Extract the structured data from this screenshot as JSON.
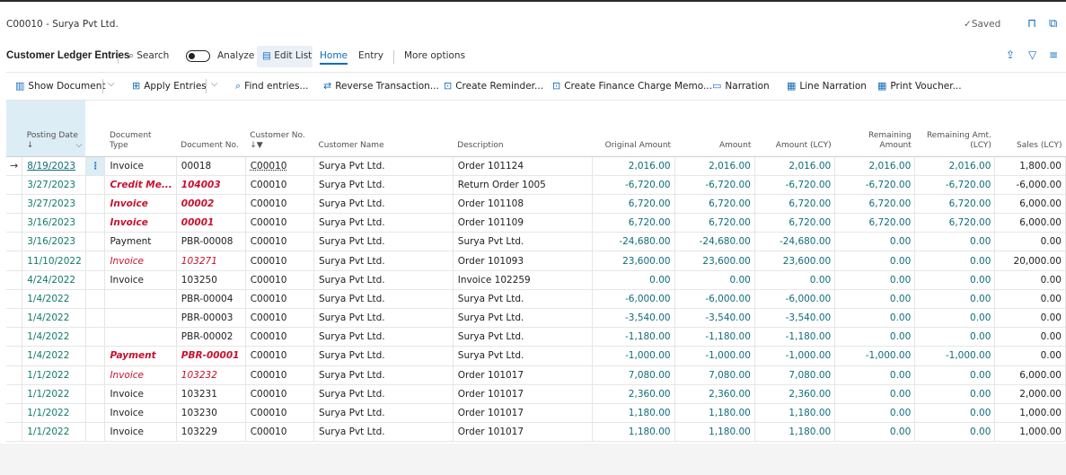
{
  "window": {
    "title": "C00010 - Surya Pvt Ltd.",
    "saved_label": "Saved"
  },
  "actionbar": {
    "page_name": "Customer Ledger Entries",
    "search": "Search",
    "analyze": "Analyze",
    "edit_list": "Edit List",
    "home": "Home",
    "entry": "Entry",
    "more": "More options"
  },
  "commands": {
    "show_document": "Show Document",
    "apply_entries": "Apply Entries",
    "find_entries": "Find entries...",
    "reverse": "Reverse Transaction...",
    "reminder": "Create Reminder...",
    "finance_memo": "Create Finance Charge Memo...",
    "narration": "Narration",
    "line_narration": "Line Narration",
    "print_voucher": "Print Voucher..."
  },
  "columns": {
    "posting_date": "Posting Date",
    "doc_type_1": "Document",
    "doc_type_2": "Type",
    "doc_no": "Document No.",
    "cust_no": "Customer No.",
    "cust_name": "Customer Name",
    "description": "Description",
    "orig_amount": "Original Amount",
    "amount": "Amount",
    "amount_lcy": "Amount (LCY)",
    "remaining_1": "Remaining",
    "remaining_2": "Amount",
    "rem_lcy_1": "Remaining Amt.",
    "rem_lcy_2": "(LCY)",
    "sales_lcy": "Sales (LCY)"
  },
  "rows": [
    {
      "date": "8/19/2023",
      "type": "Invoice",
      "docno": "00018",
      "cust": "C00010",
      "name": "Surya Pvt Ltd.",
      "desc": "Order 101124",
      "orig": "2,016.00",
      "amt": "2,016.00",
      "lcy": "2,016.00",
      "rem": "2,016.00",
      "remlcy": "2,016.00",
      "sales": "1,800.00",
      "style": ""
    },
    {
      "date": "3/27/2023",
      "type": "Credit Me...",
      "docno": "104003",
      "cust": "C00010",
      "name": "Surya Pvt Ltd.",
      "desc": "Return Order 1005",
      "orig": "-6,720.00",
      "amt": "-6,720.00",
      "lcy": "-6,720.00",
      "rem": "-6,720.00",
      "remlcy": "-6,720.00",
      "sales": "-6,000.00",
      "style": "bold"
    },
    {
      "date": "3/27/2023",
      "type": "Invoice",
      "docno": "00002",
      "cust": "C00010",
      "name": "Surya Pvt Ltd.",
      "desc": "Order 101108",
      "orig": "6,720.00",
      "amt": "6,720.00",
      "lcy": "6,720.00",
      "rem": "6,720.00",
      "remlcy": "6,720.00",
      "sales": "6,000.00",
      "style": "bold"
    },
    {
      "date": "3/16/2023",
      "type": "Invoice",
      "docno": "00001",
      "cust": "C00010",
      "name": "Surya Pvt Ltd.",
      "desc": "Order 101109",
      "orig": "6,720.00",
      "amt": "6,720.00",
      "lcy": "6,720.00",
      "rem": "6,720.00",
      "remlcy": "6,720.00",
      "sales": "6,000.00",
      "style": "bold"
    },
    {
      "date": "3/16/2023",
      "type": "Payment",
      "docno": "PBR-00008",
      "cust": "C00010",
      "name": "Surya Pvt Ltd.",
      "desc": "Surya Pvt Ltd.",
      "orig": "-24,680.00",
      "amt": "-24,680.00",
      "lcy": "-24,680.00",
      "rem": "0.00",
      "remlcy": "0.00",
      "sales": "0.00",
      "style": ""
    },
    {
      "date": "11/10/2022",
      "type": "Invoice",
      "docno": "103271",
      "cust": "C00010",
      "name": "Surya Pvt Ltd.",
      "desc": "Order 101093",
      "orig": "23,600.00",
      "amt": "23,600.00",
      "lcy": "23,600.00",
      "rem": "0.00",
      "remlcy": "0.00",
      "sales": "20,000.00",
      "style": "ital"
    },
    {
      "date": "4/24/2022",
      "type": "Invoice",
      "docno": "103250",
      "cust": "C00010",
      "name": "Surya Pvt Ltd.",
      "desc": "Invoice 102259",
      "orig": "0.00",
      "amt": "0.00",
      "lcy": "0.00",
      "rem": "0.00",
      "remlcy": "0.00",
      "sales": "0.00",
      "style": ""
    },
    {
      "date": "1/4/2022",
      "type": "",
      "docno": "PBR-00004",
      "cust": "C00010",
      "name": "Surya Pvt Ltd.",
      "desc": "Surya Pvt Ltd.",
      "orig": "-6,000.00",
      "amt": "-6,000.00",
      "lcy": "-6,000.00",
      "rem": "0.00",
      "remlcy": "0.00",
      "sales": "0.00",
      "style": ""
    },
    {
      "date": "1/4/2022",
      "type": "",
      "docno": "PBR-00003",
      "cust": "C00010",
      "name": "Surya Pvt Ltd.",
      "desc": "Surya Pvt Ltd.",
      "orig": "-3,540.00",
      "amt": "-3,540.00",
      "lcy": "-3,540.00",
      "rem": "0.00",
      "remlcy": "0.00",
      "sales": "0.00",
      "style": ""
    },
    {
      "date": "1/4/2022",
      "type": "",
      "docno": "PBR-00002",
      "cust": "C00010",
      "name": "Surya Pvt Ltd.",
      "desc": "Surya Pvt Ltd.",
      "orig": "-1,180.00",
      "amt": "-1,180.00",
      "lcy": "-1,180.00",
      "rem": "0.00",
      "remlcy": "0.00",
      "sales": "0.00",
      "style": ""
    },
    {
      "date": "1/4/2022",
      "type": "Payment",
      "docno": "PBR-00001",
      "cust": "C00010",
      "name": "Surya Pvt Ltd.",
      "desc": "Surya Pvt Ltd.",
      "orig": "-1,000.00",
      "amt": "-1,000.00",
      "lcy": "-1,000.00",
      "rem": "-1,000.00",
      "remlcy": "-1,000.00",
      "sales": "0.00",
      "style": "bold"
    },
    {
      "date": "1/1/2022",
      "type": "Invoice",
      "docno": "103232",
      "cust": "C00010",
      "name": "Surya Pvt Ltd.",
      "desc": "Order 101017",
      "orig": "7,080.00",
      "amt": "7,080.00",
      "lcy": "7,080.00",
      "rem": "0.00",
      "remlcy": "0.00",
      "sales": "6,000.00",
      "style": "ital"
    },
    {
      "date": "1/1/2022",
      "type": "Invoice",
      "docno": "103231",
      "cust": "C00010",
      "name": "Surya Pvt Ltd.",
      "desc": "Order 101017",
      "orig": "2,360.00",
      "amt": "2,360.00",
      "lcy": "2,360.00",
      "rem": "0.00",
      "remlcy": "0.00",
      "sales": "2,000.00",
      "style": ""
    },
    {
      "date": "1/1/2022",
      "type": "Invoice",
      "docno": "103230",
      "cust": "C00010",
      "name": "Surya Pvt Ltd.",
      "desc": "Order 101017",
      "orig": "1,180.00",
      "amt": "1,180.00",
      "lcy": "1,180.00",
      "rem": "0.00",
      "remlcy": "0.00",
      "sales": "1,000.00",
      "style": ""
    },
    {
      "date": "1/1/2022",
      "type": "Invoice",
      "docno": "103229",
      "cust": "C00010",
      "name": "Surya Pvt Ltd.",
      "desc": "Order 101017",
      "orig": "1,180.00",
      "amt": "1,180.00",
      "lcy": "1,180.00",
      "rem": "0.00",
      "remlcy": "0.00",
      "sales": "1,000.00",
      "style": ""
    }
  ]
}
